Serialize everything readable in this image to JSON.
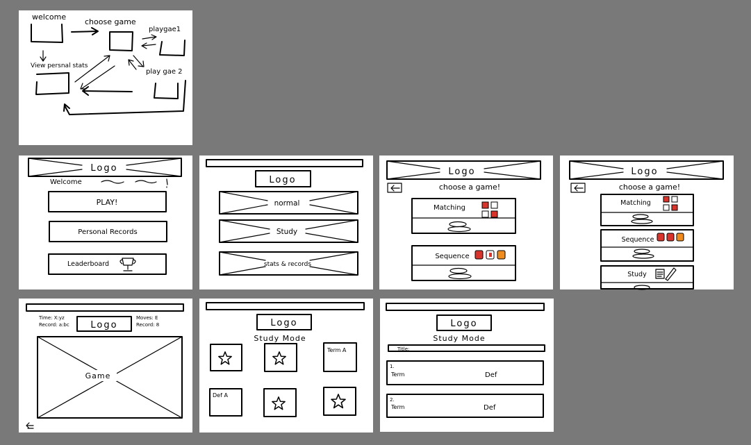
{
  "flow": {
    "welcome": "welcome",
    "choose_game": "choose game",
    "play_game_1": "playgae1",
    "play_game_2": "play gae 2",
    "view_personal_stats": "View persnal stats"
  },
  "welcome_screen": {
    "logo": "Logo",
    "welcome": "Welcome",
    "play": "PLAY!",
    "personal_records": "Personal Records",
    "leaderboard": "Leaderboard"
  },
  "mode_screen": {
    "logo": "Logo",
    "normal": "normal",
    "study": "Study",
    "stats": "stats & records"
  },
  "choose_screen_a": {
    "logo": "Logo",
    "title": "choose a game!",
    "matching": "Matching",
    "sequence": "Sequence"
  },
  "choose_screen_b": {
    "logo": "Logo",
    "title": "choose a game!",
    "matching": "Matching",
    "sequence": "Sequence",
    "study": "Study"
  },
  "game_screen": {
    "time": "Time: X:yz",
    "record_time": "Record: a:bc",
    "logo": "Logo",
    "moves": "Moves: E",
    "record_moves": "Record: 8",
    "game": "Game"
  },
  "study_grid_screen": {
    "logo": "Logo",
    "mode": "Study Mode",
    "term": "Term A",
    "def": "Def A"
  },
  "study_list_screen": {
    "logo": "Logo",
    "mode": "Study Mode",
    "title_label": "Title:",
    "rows": [
      {
        "num": "1.",
        "term": "Term",
        "def": "Def"
      },
      {
        "num": "2.",
        "term": "Term",
        "def": "Def"
      }
    ]
  },
  "colors": {
    "background": "#797979",
    "panel": "#ffffff",
    "ink": "#000000",
    "red": "#d9342b",
    "orange": "#f08c1e"
  }
}
